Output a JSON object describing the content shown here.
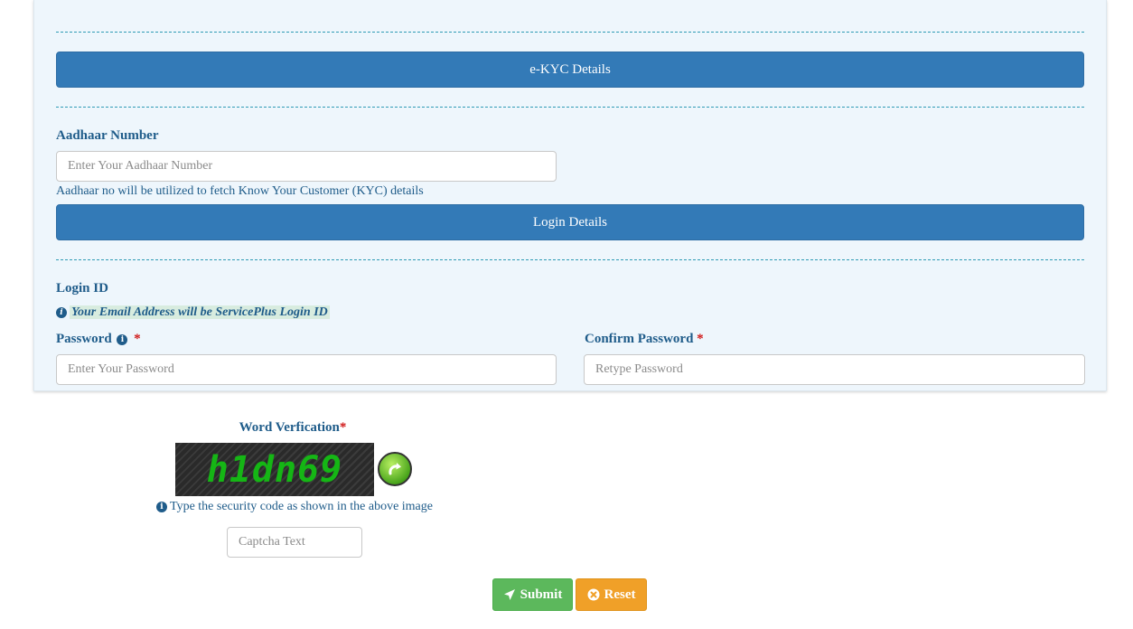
{
  "sections": {
    "ekyc_title": "e-KYC Details",
    "login_title": "Login Details"
  },
  "aadhaar": {
    "label": "Aadhaar Number",
    "placeholder": "Enter Your Aadhaar Number",
    "help": "Aadhaar no will be utilized to fetch Know Your Customer (KYC) details"
  },
  "login": {
    "label": "Login ID",
    "note": "Your Email Address will be ServicePlus Login ID"
  },
  "password": {
    "label": "Password",
    "required_mark": "*",
    "placeholder": "Enter Your Password"
  },
  "confirm_password": {
    "label": "Confirm Password",
    "required_mark": "*",
    "placeholder": "Retype Password"
  },
  "captcha": {
    "label": "Word Verfication",
    "required_mark": "*",
    "code": "h1dn69",
    "help": "Type the security code as shown in the above image",
    "placeholder": "Captcha Text"
  },
  "buttons": {
    "submit": "Submit",
    "reset": "Reset"
  },
  "icons": {
    "info": "info-circle-icon",
    "refresh": "refresh-icon",
    "submit": "paper-plane-icon",
    "reset": "times-circle-icon"
  },
  "colors": {
    "primary": "#337ab7",
    "panel_bg": "#eef6fc",
    "text": "#1f5c8a",
    "required": "#d01717",
    "submit": "#5cb85c",
    "reset": "#f0a028",
    "captcha_text": "#15b615"
  }
}
